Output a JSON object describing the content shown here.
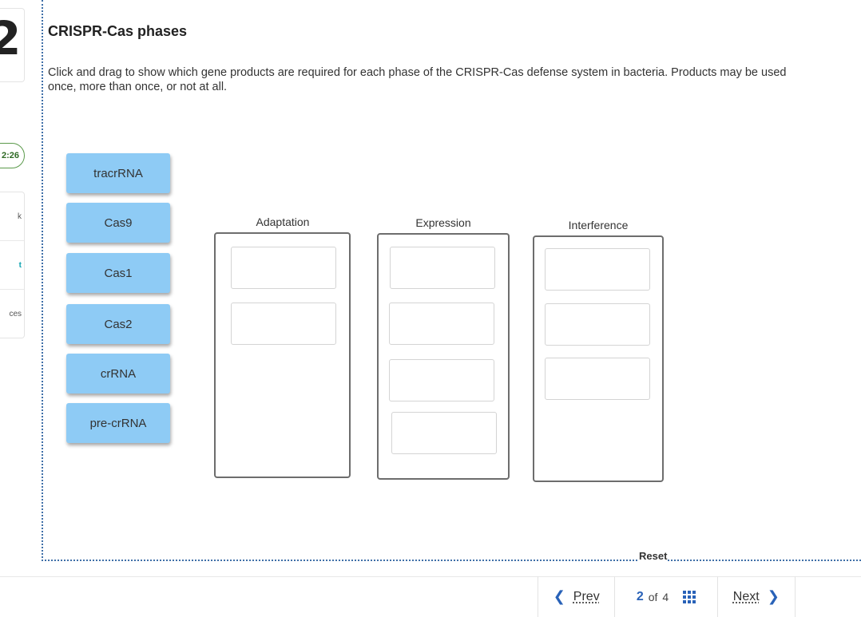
{
  "question": {
    "number": "2",
    "title": "CRISPR-Cas phases",
    "instructions": "Click and drag to show which gene products are required for each phase of the CRISPR-Cas defense system in bacteria. Products may be used once, more than once, or not at all."
  },
  "sidebar": {
    "timer": "2:26",
    "items": [
      {
        "label": "k"
      },
      {
        "label": "t"
      },
      {
        "label": "ces"
      }
    ]
  },
  "tiles": [
    {
      "label": "tracrRNA"
    },
    {
      "label": "Cas9"
    },
    {
      "label": "Cas1"
    },
    {
      "label": "Cas2"
    },
    {
      "label": "crRNA"
    },
    {
      "label": "pre-crRNA"
    }
  ],
  "zones": [
    {
      "label": "Adaptation"
    },
    {
      "label": "Expression"
    },
    {
      "label": "Interference"
    }
  ],
  "reset_label": "Reset",
  "nav": {
    "prev_label": "Prev",
    "current_page": "2",
    "of_label": "of",
    "total_pages": "4",
    "next_label": "Next"
  }
}
